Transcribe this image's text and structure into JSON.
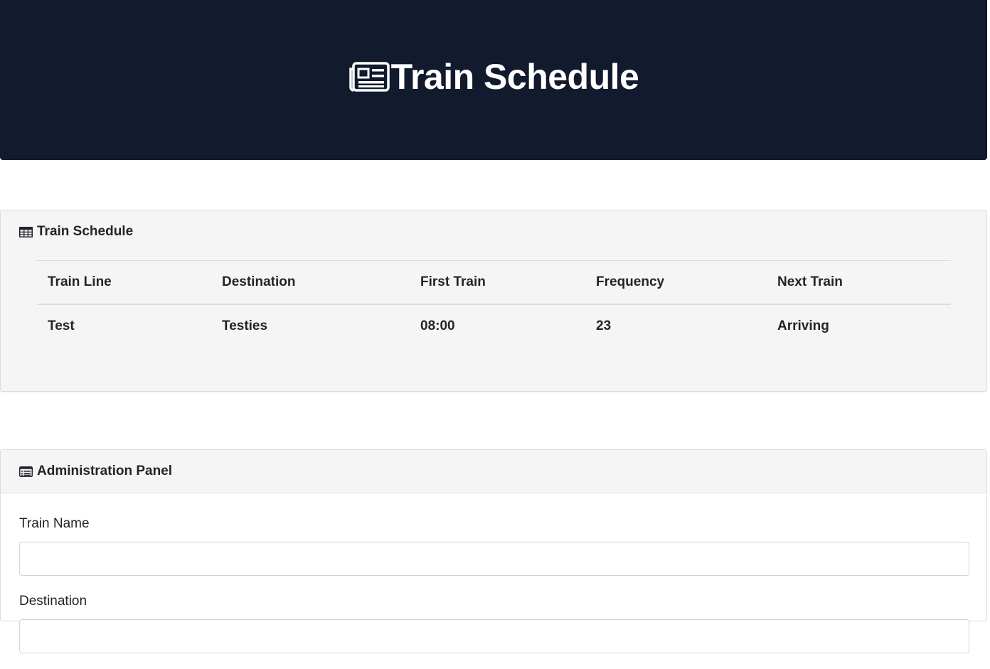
{
  "hero": {
    "title": "Train Schedule",
    "icon": "newspaper-icon"
  },
  "schedule": {
    "title": "Train Schedule",
    "icon": "table-icon",
    "columns": [
      "Train Line",
      "Destination",
      "First Train",
      "Frequency",
      "Next Train"
    ],
    "rows": [
      [
        "Test",
        "Testies",
        "08:00",
        "23",
        "Arriving"
      ]
    ]
  },
  "admin": {
    "title": "Administration Panel",
    "icon": "list-alt-icon",
    "fields": [
      {
        "label": "Train Name",
        "value": ""
      },
      {
        "label": "Destination",
        "value": ""
      }
    ]
  },
  "colors": {
    "hero_bg": "#121a2e",
    "card_bg": "#f5f5f5",
    "text": "#212529"
  }
}
